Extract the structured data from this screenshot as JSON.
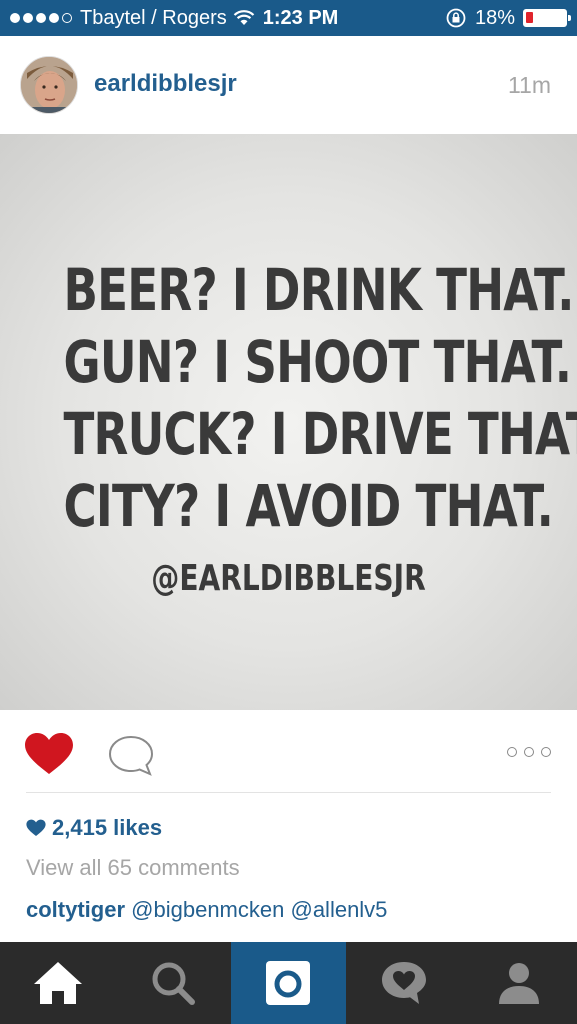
{
  "status_bar": {
    "carrier": "Tbaytel / Rogers",
    "time": "1:23 PM",
    "battery_percent": "18%",
    "battery_level": 0.18,
    "signal_bars_filled": 4,
    "signal_bars_total": 5
  },
  "post": {
    "username": "earldibblesjr",
    "timestamp": "11m",
    "image": {
      "lines": [
        "BEER? I DRINK THAT.",
        "GUN? I SHOOT THAT.",
        "TRUCK? I DRIVE THAT.",
        "CITY? I AVOID THAT."
      ],
      "handle": "@EARLDIBBLESJR"
    },
    "liked": true,
    "likes": "2,415 likes",
    "view_comments": "View all 65 comments",
    "comments": [
      {
        "author": "coltytiger",
        "mentions": [
          "@bigbenmcken",
          "@allenlv5"
        ]
      }
    ]
  },
  "tab_bar": {
    "tabs": [
      {
        "icon": "home-icon",
        "active": false
      },
      {
        "icon": "search-icon",
        "active": false
      },
      {
        "icon": "camera-icon",
        "active": true
      },
      {
        "icon": "activity-icon",
        "active": false
      },
      {
        "icon": "profile-icon",
        "active": false
      }
    ]
  },
  "colors": {
    "brand_blue": "#1a5a8a",
    "link_blue": "#235f8f",
    "like_red": "#d0161f",
    "tab_bar": "#2b2b2b"
  }
}
